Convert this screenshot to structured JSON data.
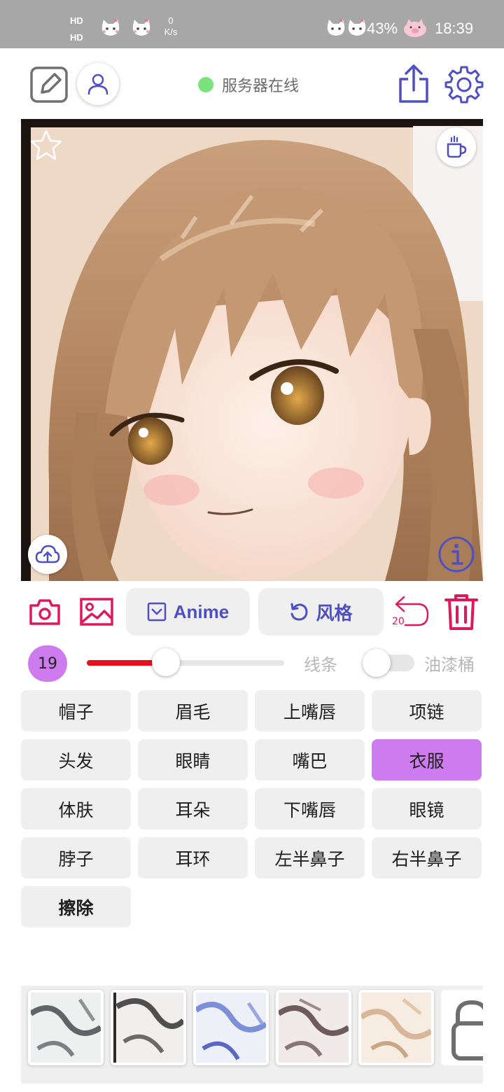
{
  "status_bar": {
    "hd_top": "HD",
    "hd_bottom": "HD",
    "net_speed_value": "0",
    "net_speed_unit": "K/s",
    "battery": "43%",
    "time": "18:39"
  },
  "toolbar": {
    "server_status": "服务器在线",
    "server_color": "#7be37b",
    "icons": [
      "edit-icon",
      "user-icon",
      "share-icon",
      "settings-icon"
    ]
  },
  "canvas": {
    "corner_icons": [
      "star-icon",
      "coffee-icon",
      "upload-icon",
      "info-icon"
    ]
  },
  "tools": {
    "model_label": "Anime",
    "style_label": "风格",
    "undo_count": "20",
    "icons": [
      "camera-icon",
      "gallery-icon",
      "undo-icon",
      "trash-icon"
    ]
  },
  "brush": {
    "size": "19",
    "slider_value": 0.4,
    "line_label": "线条",
    "bucket_label": "油漆桶",
    "bucket_enabled": false,
    "accent": "#cf7bf0",
    "slider_color": "#e8101c"
  },
  "segments": [
    {
      "label": "帽子",
      "active": false
    },
    {
      "label": "眉毛",
      "active": false
    },
    {
      "label": "上嘴唇",
      "active": false
    },
    {
      "label": "项链",
      "active": false
    },
    {
      "label": "头发",
      "active": false
    },
    {
      "label": "眼睛",
      "active": false
    },
    {
      "label": "嘴巴",
      "active": false
    },
    {
      "label": "衣服",
      "active": true
    },
    {
      "label": "体肤",
      "active": false
    },
    {
      "label": "耳朵",
      "active": false
    },
    {
      "label": "下嘴唇",
      "active": false
    },
    {
      "label": "眼镜",
      "active": false
    },
    {
      "label": "脖子",
      "active": false
    },
    {
      "label": "耳环",
      "active": false
    },
    {
      "label": "左半鼻子",
      "active": false
    },
    {
      "label": "右半鼻子",
      "active": false
    },
    {
      "label": "擦除",
      "active": false
    }
  ],
  "styles_strip": {
    "items": [
      "style-thumb-1",
      "style-thumb-2",
      "style-thumb-3",
      "style-thumb-4",
      "style-thumb-5",
      "lock-icon"
    ]
  }
}
